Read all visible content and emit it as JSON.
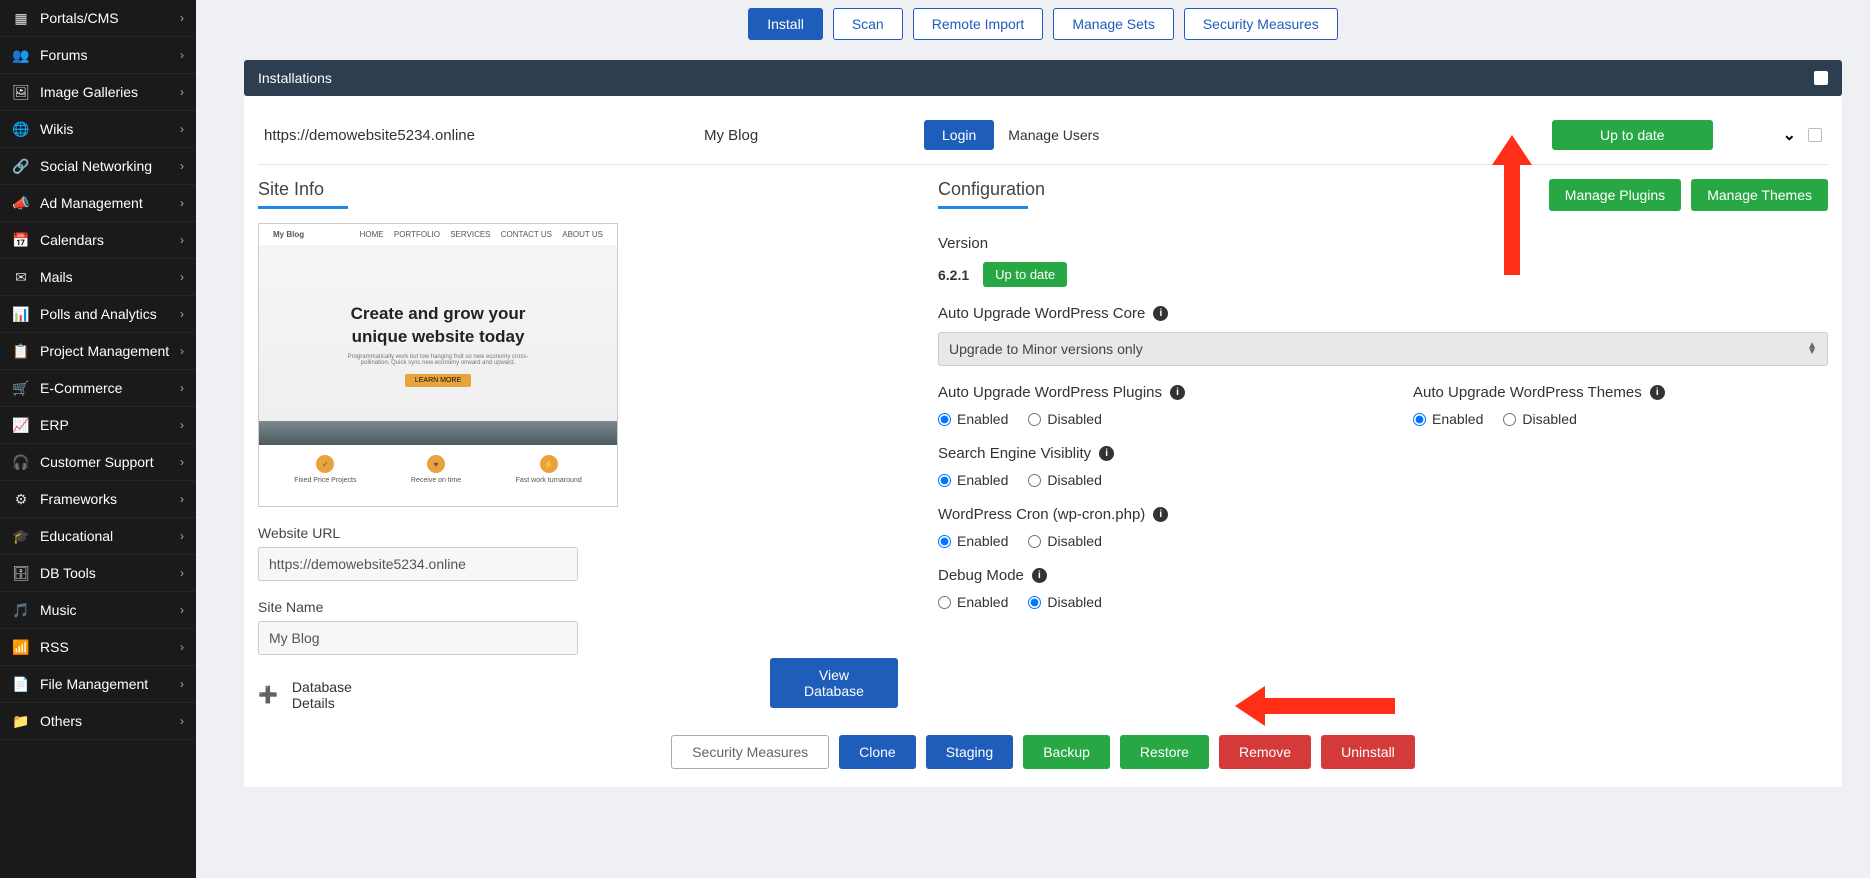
{
  "sidebar": {
    "items": [
      {
        "label": "Portals/CMS",
        "icon": "layout-grid"
      },
      {
        "label": "Forums",
        "icon": "users"
      },
      {
        "label": "Image Galleries",
        "icon": "image"
      },
      {
        "label": "Wikis",
        "icon": "globe"
      },
      {
        "label": "Social Networking",
        "icon": "share"
      },
      {
        "label": "Ad Management",
        "icon": "megaphone"
      },
      {
        "label": "Calendars",
        "icon": "calendar"
      },
      {
        "label": "Mails",
        "icon": "mail"
      },
      {
        "label": "Polls and Analytics",
        "icon": "bar-chart"
      },
      {
        "label": "Project Management",
        "icon": "clipboard"
      },
      {
        "label": "E-Commerce",
        "icon": "cart"
      },
      {
        "label": "ERP",
        "icon": "chart"
      },
      {
        "label": "Customer Support",
        "icon": "headset"
      },
      {
        "label": "Frameworks",
        "icon": "gear"
      },
      {
        "label": "Educational",
        "icon": "grad-cap"
      },
      {
        "label": "DB Tools",
        "icon": "database"
      },
      {
        "label": "Music",
        "icon": "music"
      },
      {
        "label": "RSS",
        "icon": "rss"
      },
      {
        "label": "File Management",
        "icon": "file"
      },
      {
        "label": "Others",
        "icon": "folder"
      }
    ]
  },
  "tabs": [
    "Install",
    "Scan",
    "Remote Import",
    "Manage Sets",
    "Security Measures"
  ],
  "section_header": "Installations",
  "install": {
    "url": "https://demowebsite5234.online",
    "title": "My Blog",
    "login_label": "Login",
    "manage_users_label": "Manage Users",
    "uptodate_label": "Up to date"
  },
  "siteinfo": {
    "heading": "Site Info",
    "preview": {
      "brand": "My Blog",
      "menu": [
        "HOME",
        "PORTFOLIO",
        "SERVICES",
        "CONTACT US",
        "ABOUT US"
      ],
      "hero_line1": "Create and grow your",
      "hero_line2": "unique website today",
      "hero_sub": "Programmatically work but low hanging fruit so new economy cross-pollination. Quick sync new economy onward and upward.",
      "cta": "LEARN MORE",
      "features": [
        "Fixed Price Projects",
        "Receive on time",
        "Fast work turnaround"
      ]
    },
    "url_label": "Website URL",
    "url_value": "https://demowebsite5234.online",
    "sitename_label": "Site Name",
    "sitename_value": "My Blog",
    "db_details_label": "Database Details",
    "view_db_label": "View Database"
  },
  "config": {
    "heading": "Configuration",
    "manage_plugins_label": "Manage Plugins",
    "manage_themes_label": "Manage Themes",
    "version_label": "Version",
    "version_value": "6.2.1",
    "version_badge": "Up to date",
    "auto_core_label": "Auto Upgrade WordPress Core",
    "auto_core_value": "Upgrade to Minor versions only",
    "auto_plugins_label": "Auto Upgrade WordPress Plugins",
    "auto_themes_label": "Auto Upgrade WordPress Themes",
    "seo_label": "Search Engine Visiblity",
    "cron_label": "WordPress Cron (wp-cron.php)",
    "debug_label": "Debug Mode",
    "enabled": "Enabled",
    "disabled": "Disabled"
  },
  "actions": {
    "security": "Security Measures",
    "clone": "Clone",
    "staging": "Staging",
    "backup": "Backup",
    "restore": "Restore",
    "remove": "Remove",
    "uninstall": "Uninstall"
  }
}
